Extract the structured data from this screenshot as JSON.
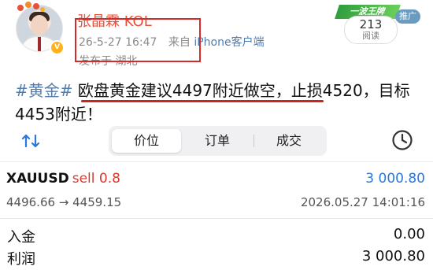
{
  "post": {
    "username": "张晶霖 KOL",
    "time": "26-5-27 16:47",
    "source_prefix": "来自",
    "device": "iPhone客户端",
    "location": "发布于 湖北",
    "stamp": "一波王牌",
    "push_badge": "推广",
    "read_count": "213",
    "read_label": "阅读",
    "content_topic": "#黄金#",
    "content_text": " 欧盘黄金建议4497附近做空，止损4520，目标4453附近！"
  },
  "tabs": {
    "items": [
      "价位",
      "订单",
      "成交"
    ],
    "active_index": 0
  },
  "trade": {
    "symbol": "XAUUSD",
    "side": "sell 0.8",
    "profit": "3 000.80",
    "prices": "4496.66 → 4459.15",
    "time": "2026.05.27 14:01:16"
  },
  "summary": {
    "deposit_label": "入金",
    "deposit_value": "0.00",
    "profit_label": "利润",
    "profit_value": "3 000.80"
  },
  "colors": {
    "username": "#e8503a",
    "topic": "#507daf",
    "highlight_box": "#d62b2b",
    "sell": "#d73a2f",
    "profit": "#2a78d8"
  },
  "icons": [
    "verified-icon",
    "sort-icon",
    "clock-icon"
  ]
}
